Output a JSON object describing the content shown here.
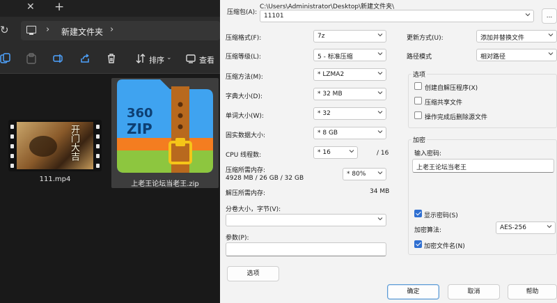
{
  "explorer": {
    "tab_close": "✕",
    "tab_add": "+",
    "breadcrumb_folder": "新建文件夹",
    "toolbar": {
      "sort_label": "排序",
      "view_label": "查看"
    },
    "files": [
      {
        "name": "111.mp4"
      },
      {
        "name": "上老王论坛当老王.zip"
      }
    ],
    "zip_icon_text": {
      "line1": "360",
      "line2": "ZIP"
    },
    "video_title_glyphs": "开门大吉"
  },
  "dialog": {
    "archive_label": "压缩包(A):",
    "archive_path": "C:\\Users\\Administrator\\Desktop\\新建文件夹\\",
    "archive_name": "11101",
    "browse_button": "...",
    "format_label": "压缩格式(F):",
    "format_value": "7z",
    "level_label": "压缩等级(L):",
    "level_value": "5 - 标准压缩",
    "method_label": "压缩方法(M):",
    "method_value": "* LZMA2",
    "dict_label": "字典大小(D):",
    "dict_value": "* 32 MB",
    "word_label": "单词大小(W):",
    "word_value": "* 32",
    "solid_label": "固实数据大小:",
    "solid_value": "* 8 GB",
    "threads_label": "CPU 线程数:",
    "threads_value": "* 16",
    "threads_total": "/ 16",
    "mem_comp_label": "压缩所需内存:",
    "mem_comp_value": "4928 MB / 26 GB / 32 GB",
    "mem_percent": "* 80%",
    "mem_decomp_label": "解压所需内存:",
    "mem_decomp_value": "34 MB",
    "split_label": "分卷大小，字节(V):",
    "split_value": "",
    "params_label": "参数(P):",
    "params_value": "",
    "options_button": "选项",
    "update_label": "更新方式(U):",
    "update_value": "添加并替换文件",
    "path_mode_label": "路径模式",
    "path_mode_value": "相对路径",
    "options_group_title": "选项",
    "opt_sfx": "创建自解压程序(X)",
    "opt_shared": "压缩共享文件",
    "opt_delete": "操作完成后删除源文件",
    "encrypt_group_title": "加密",
    "password_label": "输入密码:",
    "password_value": "上老王论坛当老王",
    "show_password": "显示密码(S)",
    "enc_method_label": "加密算法:",
    "enc_method_value": "AES-256",
    "encrypt_names": "加密文件名(N)",
    "ok_button": "确定",
    "cancel_button": "取消",
    "help_button": "帮助"
  },
  "colors": {
    "accent": "#2f6fd1",
    "zip_blue": "#3fa3f0",
    "zip_orange": "#f47d20",
    "zip_green": "#8dc63f",
    "zip_strap": "#b8691e"
  }
}
